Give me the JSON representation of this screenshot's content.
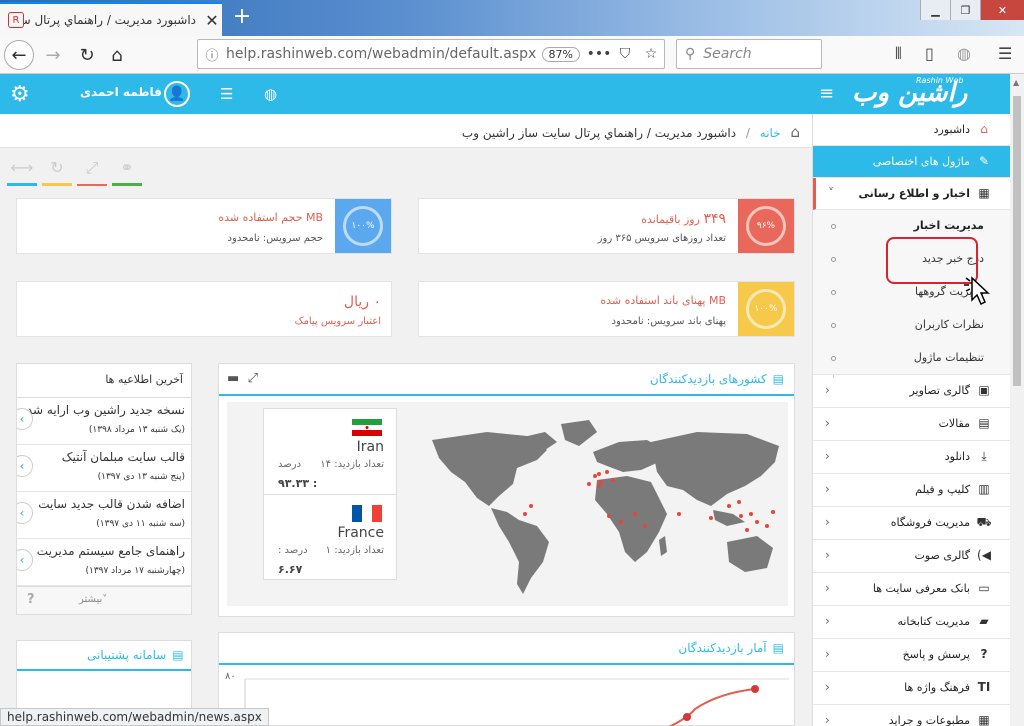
{
  "browser": {
    "tab_title": "داشبورد مديريت / راهنماي پرتال سا",
    "url": "help.rashinweb.com/webadmin/default.aspx",
    "zoom": "87%",
    "search_placeholder": "Search",
    "status_url": "help.rashinweb.com/webadmin/news.aspx"
  },
  "header": {
    "user_name": "فاطمه احمدی",
    "logo_text": "راشین وب",
    "logo_sub": "Rashin Web"
  },
  "breadcrumb": {
    "home": "خانه",
    "sep": "/",
    "current": "داشبورد مديريت / راهنماي پرتال سايت ساز راشين وب"
  },
  "cards": {
    "storage": {
      "ring": "۱۰۰%",
      "line1": "MB حجم استفاده شده",
      "line2": "حجم سرویس: نامحدود",
      "color": "#5ba8ef"
    },
    "days": {
      "ring": "۹۶%",
      "value": "۳۴۹",
      "line1": "روز باقیمانده",
      "line2": "تعداد روزهای سرویس ۳۶۵ روز",
      "color": "#e8695c"
    },
    "sms": {
      "value": "۰ ریال",
      "line2": "اعتبار سرویس پیامک"
    },
    "bandwidth": {
      "ring": "۱۰۰%",
      "line1": "MB پهنای باند استفاده شده",
      "line2": "پهنای باند سرویس: نامحدود",
      "color": "#f6c94a"
    }
  },
  "map_panel": {
    "title": "کشورهای بازدیدکنندگان",
    "countries": [
      {
        "name": "Iran",
        "visits_label": "تعداد بازدید: ۱۴",
        "pct_label": "درصد",
        "pct": "۹۳.۳۳ :"
      },
      {
        "name": "France",
        "visits_label": "تعداد بازدید: ۱",
        "pct_label": "درصد :",
        "pct": "۶.۶۷"
      }
    ]
  },
  "news_panel": {
    "title": "آخرین اطلاعیه ها",
    "items": [
      {
        "title": "نسخه جدید راشین وب ارایه شد",
        "date": "(یک شنبه ۱۳ مرداد ۱۳۹۸)"
      },
      {
        "title": "قالب سایت مبلمان آنتیک",
        "date": "(پنج شنبه ۱۳ دی ۱۳۹۷)"
      },
      {
        "title": "اضافه شدن قالب جدید سایت",
        "date": "(سه شنبه ۱۱ دی ۱۳۹۷)"
      },
      {
        "title": "راهنمای جامع سیستم مدیریت",
        "date": "(چهارشنبه ۱۷ مرداد ۱۳۹۷)"
      }
    ],
    "more": "بیشتر",
    "help": "?"
  },
  "stats_panel": {
    "title": "آمار بازدیدکنندگان",
    "y_tick": "۸۰"
  },
  "support_panel": {
    "title": "سامانه پشتیبانی"
  },
  "sidebar": {
    "dashboard": "داشبورد",
    "custom_modules": "ماژول های اختصاصی",
    "news": "اخبار و اطلاع رسانی",
    "news_sub": [
      "مدیریت اخبار",
      "درج خبر جدید",
      "مدیریت گروهها",
      "نظرات کاربران",
      "تنظیمات ماژول"
    ],
    "items": [
      "گالری تصاویر",
      "مقالات",
      "دانلود",
      "کلیپ و فیلم",
      "مدیریت فروشگاه",
      "گالری صوت",
      "بانک معرفی سایت ها",
      "مدیریت کتابخانه",
      "پرسش و پاسخ",
      "فرهنگ واژه ها",
      "مطبوعات و جراید"
    ]
  }
}
